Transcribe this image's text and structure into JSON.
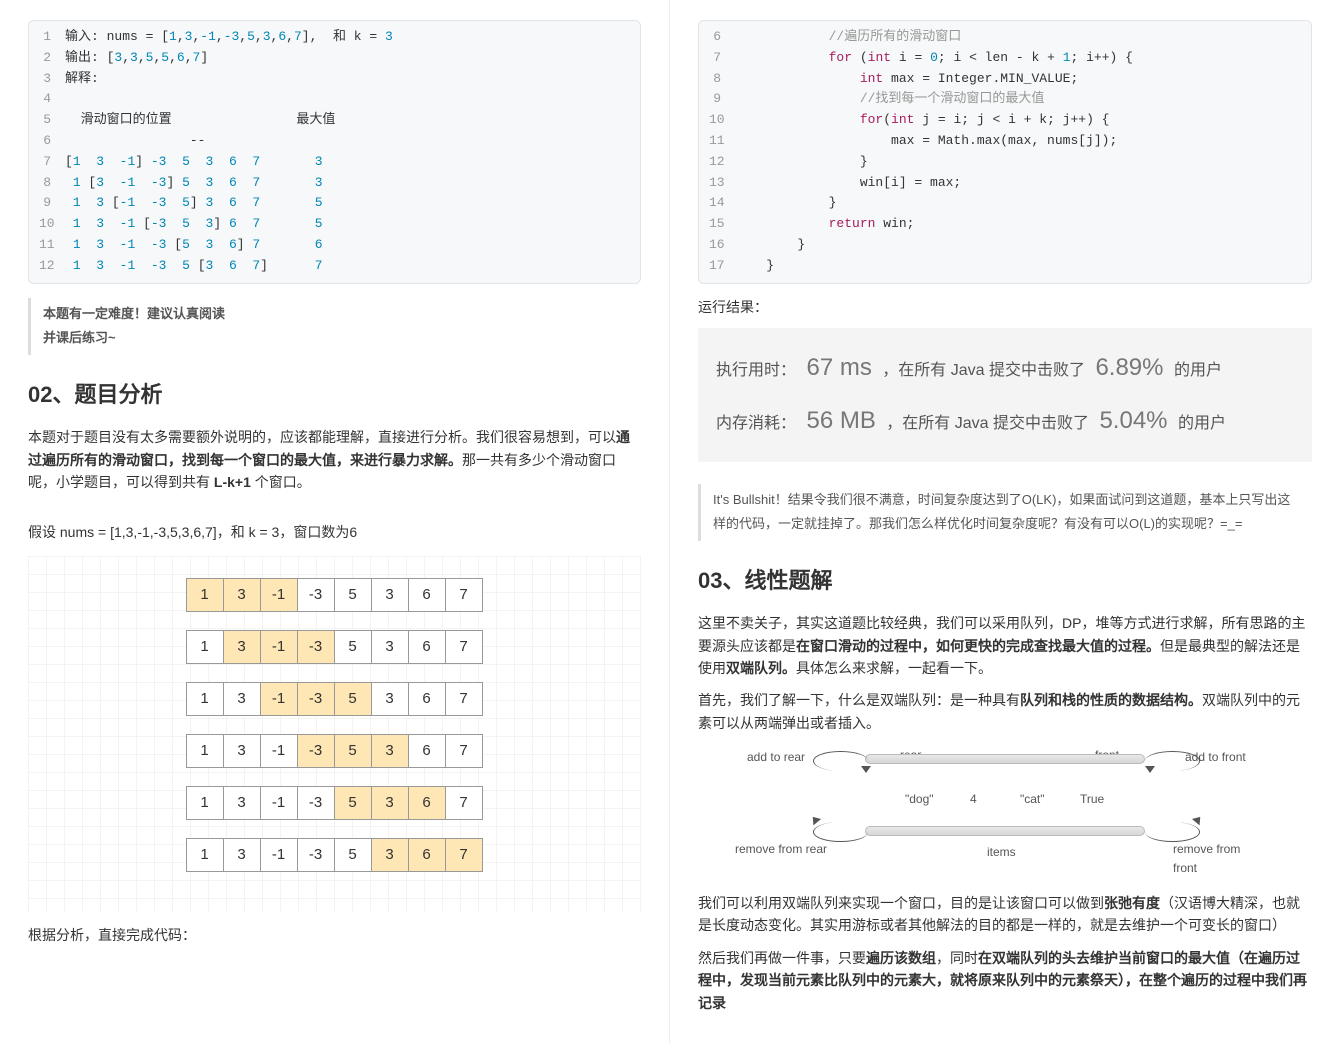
{
  "left": {
    "code1": {
      "lines": [
        {
          "n": "1",
          "html": "输入: nums = [<span class='nm'>1</span>,<span class='nm'>3</span>,<span class='nm'>-1</span>,<span class='nm'>-3</span>,<span class='nm'>5</span>,<span class='nm'>3</span>,<span class='nm'>6</span>,<span class='nm'>7</span>],  和 k = <span class='nm'>3</span>"
        },
        {
          "n": "2",
          "html": "输出: [<span class='nm'>3</span>,<span class='nm'>3</span>,<span class='nm'>5</span>,<span class='nm'>5</span>,<span class='nm'>6</span>,<span class='nm'>7</span>]"
        },
        {
          "n": "3",
          "html": "解释:"
        },
        {
          "n": "4",
          "html": ""
        },
        {
          "n": "5",
          "html": "  滑动窗口的位置                最大值"
        },
        {
          "n": "6",
          "html": "                --"
        },
        {
          "n": "7",
          "html": "[<span class='nm'>1</span>  <span class='nm'>3</span>  <span class='nm'>-1</span>] <span class='nm'>-3</span>  <span class='nm'>5</span>  <span class='nm'>3</span>  <span class='nm'>6</span>  <span class='nm'>7</span>       <span class='nm'>3</span>"
        },
        {
          "n": "8",
          "html": " <span class='nm'>1</span> [<span class='nm'>3</span>  <span class='nm'>-1</span>  <span class='nm'>-3</span>] <span class='nm'>5</span>  <span class='nm'>3</span>  <span class='nm'>6</span>  <span class='nm'>7</span>       <span class='nm'>3</span>"
        },
        {
          "n": "9",
          "html": " <span class='nm'>1</span>  <span class='nm'>3</span> [<span class='nm'>-1</span>  <span class='nm'>-3</span>  <span class='nm'>5</span>] <span class='nm'>3</span>  <span class='nm'>6</span>  <span class='nm'>7</span>       <span class='nm'>5</span>"
        },
        {
          "n": "10",
          "html": " <span class='nm'>1</span>  <span class='nm'>3</span>  <span class='nm'>-1</span> [<span class='nm'>-3</span>  <span class='nm'>5</span>  <span class='nm'>3</span>] <span class='nm'>6</span>  <span class='nm'>7</span>       <span class='nm'>5</span>"
        },
        {
          "n": "11",
          "html": " <span class='nm'>1</span>  <span class='nm'>3</span>  <span class='nm'>-1</span>  <span class='nm'>-3</span> [<span class='nm'>5</span>  <span class='nm'>3</span>  <span class='nm'>6</span>] <span class='nm'>7</span>       <span class='nm'>6</span>"
        },
        {
          "n": "12",
          "html": " <span class='nm'>1</span>  <span class='nm'>3</span>  <span class='nm'>-1</span>  <span class='nm'>-3</span>  <span class='nm'>5</span> [<span class='nm'>3</span>  <span class='nm'>6</span>  <span class='nm'>7</span>]      <span class='nm'>7</span>"
        }
      ]
    },
    "quote": {
      "line1": "本题有一定难度！建议认真阅读",
      "line2": "并课后练习~"
    },
    "h2": "02、题目分析",
    "para1a": "本题对于题目没有太多需要额外说明的，应该都能理解，直接进行分析。我们很容易想到，可以",
    "para1b": "通过遍历所有的滑动窗口，找到每一个窗口的最大值，来进行暴力求解。",
    "para1c": "那一共有多少个滑动窗口呢，小学题目，可以得到共有 ",
    "para1d": "L-k+1",
    "para1e": " 个窗口。",
    "assume": "假设 nums = [1,3,-1,-3,5,3,6,7]，和 k = 3，窗口数为6",
    "windows": {
      "values": [
        "1",
        "3",
        "-1",
        "-3",
        "5",
        "3",
        "6",
        "7"
      ],
      "rows": [
        {
          "hl": [
            0,
            1,
            2
          ]
        },
        {
          "hl": [
            1,
            2,
            3
          ]
        },
        {
          "hl": [
            2,
            3,
            4
          ]
        },
        {
          "hl": [
            3,
            4,
            5
          ]
        },
        {
          "hl": [
            4,
            5,
            6
          ]
        },
        {
          "hl": [
            5,
            6,
            7
          ]
        }
      ]
    },
    "para2": "根据分析，直接完成代码："
  },
  "right": {
    "code2": {
      "lines": [
        {
          "n": "6",
          "html": "            <span class='cm'>//遍历所有的滑动窗口</span>"
        },
        {
          "n": "7",
          "html": "            <span class='kw'>for</span> (<span class='kw'>int</span> i = <span class='nm'>0</span>; i &lt; len - k + <span class='nm'>1</span>; i++) {"
        },
        {
          "n": "8",
          "html": "                <span class='kw'>int</span> max = Integer.MIN_VALUE;"
        },
        {
          "n": "9",
          "html": "                <span class='cm'>//找到每一个滑动窗口的最大值</span>"
        },
        {
          "n": "10",
          "html": "                <span class='kw'>for</span>(<span class='kw'>int</span> j = i; j &lt; i + k; j++) {"
        },
        {
          "n": "11",
          "html": "                    max = Math.max(max, nums[j]);"
        },
        {
          "n": "12",
          "html": "                }"
        },
        {
          "n": "13",
          "html": "                win[i] = max;"
        },
        {
          "n": "14",
          "html": "            }"
        },
        {
          "n": "15",
          "html": "            <span class='kw'>return</span> win;"
        },
        {
          "n": "16",
          "html": "        }"
        },
        {
          "n": "17",
          "html": "    }"
        }
      ]
    },
    "runresult_label": "运行结果：",
    "result": {
      "time_label": "执行用时：",
      "time": "67 ms",
      "time_mid": "，在所有 Java 提交中击败了",
      "time_pct": "6.89%",
      "time_suffix": " 的用户",
      "mem_label": "内存消耗：",
      "mem": "56 MB",
      "mem_mid": "，在所有 Java 提交中击败了",
      "mem_pct": "5.04%",
      "mem_suffix": " 的用户"
    },
    "quote": "It's Bullshit！结果令我们很不满意，时间复杂度达到了O(LK)，如果面试问到这道题，基本上只写出这样的代码，一定就挂掉了。那我们怎么样优化时间复杂度呢？有没有可以O(L)的实现呢？=_=",
    "h2": "03、线性题解",
    "p1a": "这里不卖关子，其实这道题比较经典，我们可以采用队列，DP，堆等方式进行求解，所有思路的主要源头应该都是",
    "p1b": "在窗口滑动的过程中，如何更快的完成查找最大值的过程。",
    "p1c": "但是最典型的解法还是使用",
    "p1d": "双端队列。",
    "p1e": "具体怎么来求解，一起看一下。",
    "p2a": "首先，我们了解一下，什么是双端队列：是一种具有",
    "p2b": "队列和栈的性质的数据结构。",
    "p2c": "双端队列中的元素可以从两端弹出或者插入。",
    "diagram": {
      "rear": "rear",
      "front": "front",
      "add_rear": "add to rear",
      "add_front": "add to front",
      "rm_rear": "remove from rear",
      "rm_front": "remove from front",
      "items": "items",
      "v1": "\"dog\"",
      "v2": "4",
      "v3": "\"cat\"",
      "v4": "True"
    },
    "p3a": "我们可以利用双端队列来实现一个窗口，目的是让该窗口可以做到",
    "p3b": "张弛有度",
    "p3c": "（汉语博大精深，也就是长度动态变化。其实用游标或者其他解法的目的都是一样的，就是去维护一个可变长的窗口）",
    "p4a": "然后我们再做一件事，只要",
    "p4b": "遍历该数组",
    "p4c": "，同时",
    "p4d": "在双端队列的头去维护当前窗口的最大值（在遍历过程中，发现当前元素比队列中的元素大，就将原来队列中的元素祭天），在整个遍历的过程中我们再记录"
  }
}
